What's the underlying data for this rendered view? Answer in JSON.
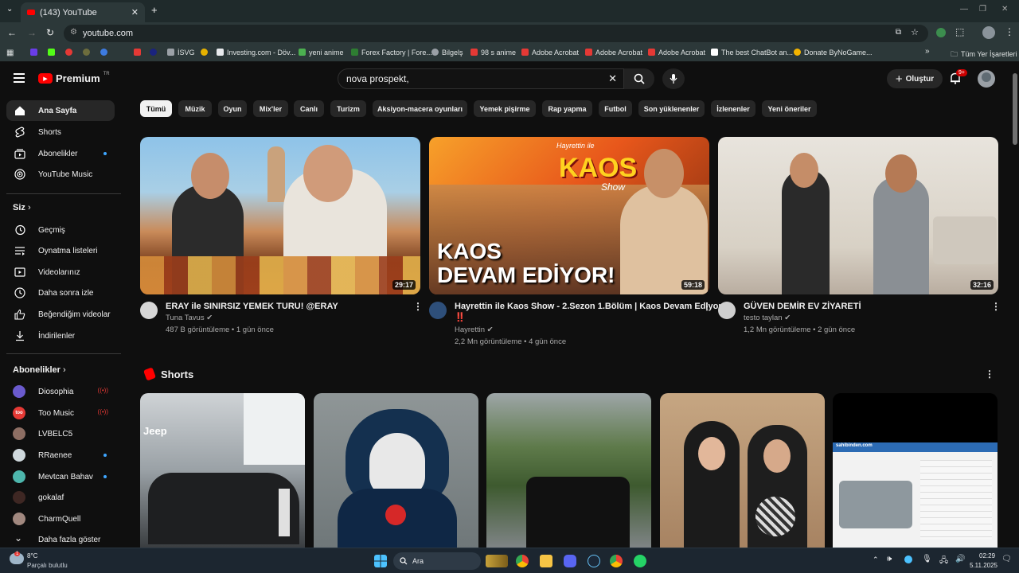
{
  "browser": {
    "tab_title": "(143) YouTube",
    "url": "youtube.com",
    "bookmarks": [
      {
        "label": "İSVG",
        "color": "#9aa0a6"
      },
      {
        "label": "Investing.com - Döv...",
        "color": "#e8eaed"
      },
      {
        "label": "yeni anime",
        "color": "#4caf50"
      },
      {
        "label": "Forex Factory | Fore...",
        "color": "#2e7d32"
      },
      {
        "label": "Bilgelş",
        "color": "#9aa0a6"
      },
      {
        "label": "98 s anime",
        "color": "#e53935"
      },
      {
        "label": "Adobe Acrobat",
        "color": "#e53935"
      },
      {
        "label": "Adobe Acrobat",
        "color": "#e53935"
      },
      {
        "label": "Adobe Acrobat",
        "color": "#e53935"
      },
      {
        "label": "The best ChatBot an...",
        "color": "#ffffff"
      },
      {
        "label": "Donate ByNoGame...",
        "color": "#f4b400"
      }
    ],
    "all_bookmarks": "Tüm Yer İşaretleri"
  },
  "header": {
    "logo": "Premium",
    "logo_sup": "TR",
    "search_value": "nova prospekt,",
    "create_label": "Oluştur",
    "notif_badge": "9+"
  },
  "sidebar": {
    "main": [
      {
        "label": "Ana Sayfa",
        "icon": "home-icon",
        "active": true
      },
      {
        "label": "Shorts",
        "icon": "shorts-icon"
      },
      {
        "label": "Abonelikler",
        "icon": "subscriptions-icon",
        "dot": true
      },
      {
        "label": "YouTube Music",
        "icon": "music-icon"
      }
    ],
    "you_title": "Siz",
    "you": [
      {
        "label": "Geçmiş",
        "icon": "history-icon"
      },
      {
        "label": "Oynatma listeleri",
        "icon": "playlists-icon"
      },
      {
        "label": "Videolarınız",
        "icon": "your-videos-icon"
      },
      {
        "label": "Daha sonra izle",
        "icon": "watch-later-icon"
      },
      {
        "label": "Beğendiğim videolar",
        "icon": "like-icon"
      },
      {
        "label": "İndirilenler",
        "icon": "download-icon"
      }
    ],
    "subs_title": "Abonelikler",
    "subs": [
      {
        "label": "Diosophia",
        "color": "#6a5acd",
        "live": true
      },
      {
        "label": "Too Music",
        "color": "#e53935",
        "live": true
      },
      {
        "label": "LVBELC5",
        "color": "#8d6e63"
      },
      {
        "label": "RRaenee",
        "color": "#cfd8dc",
        "dot": true
      },
      {
        "label": "Mevtcan Bahav",
        "color": "#4db6ac",
        "dot": true
      },
      {
        "label": "gokalaf",
        "color": "#3e2723"
      },
      {
        "label": "CharmQuell",
        "color": "#a1887f"
      }
    ],
    "more": "Daha fazla göster"
  },
  "chips": [
    "Tümü",
    "Müzik",
    "Oyun",
    "Mix'ler",
    "Canlı",
    "Turizm",
    "Aksiyon-macera oyunları",
    "Yemek pişirme",
    "Rap yapma",
    "Futbol",
    "Son yüklenenler",
    "İzlenenler",
    "Yeni öneriler"
  ],
  "videos": [
    {
      "title": "ERAY ile SINIRSIZ YEMEK TURU! @ERAY",
      "channel": "Tuna Tavus",
      "meta": "487 B görüntüleme • 1 gün önce",
      "duration": "29:17",
      "extra": ""
    },
    {
      "title": "Hayrettin ile Kaos Show - 2.Sezon 1.Bölüm | Kaos Devam Ediyor",
      "channel": "Hayrettin",
      "meta": "2,2 Mn görüntüleme • 4 gün önce",
      "duration": "59:18",
      "extra": "‼️"
    },
    {
      "title": "GÜVEN DEMİR EV ZİYARETİ",
      "channel": "testo taylan",
      "meta": "1,2 Mn görüntüleme • 2 gün önce",
      "duration": "32:16",
      "extra": ""
    }
  ],
  "thumb_text": {
    "kaos_logo": "KAOS",
    "kaos_sub": "Show",
    "kaos_top": "Hayrettin ile",
    "kaos_line1": "KAOS",
    "kaos_line2": "DEVAM EDİYOR!"
  },
  "shorts_title": "Shorts",
  "short_text": {
    "jeep": "Jeep",
    "site": "sahibinden.com"
  },
  "taskbar": {
    "weather_temp": "8°C",
    "weather_desc": "Parçalı bulutlu",
    "search": "Ara",
    "time": "02:29",
    "date": "5.11.2025",
    "badge": "1"
  }
}
